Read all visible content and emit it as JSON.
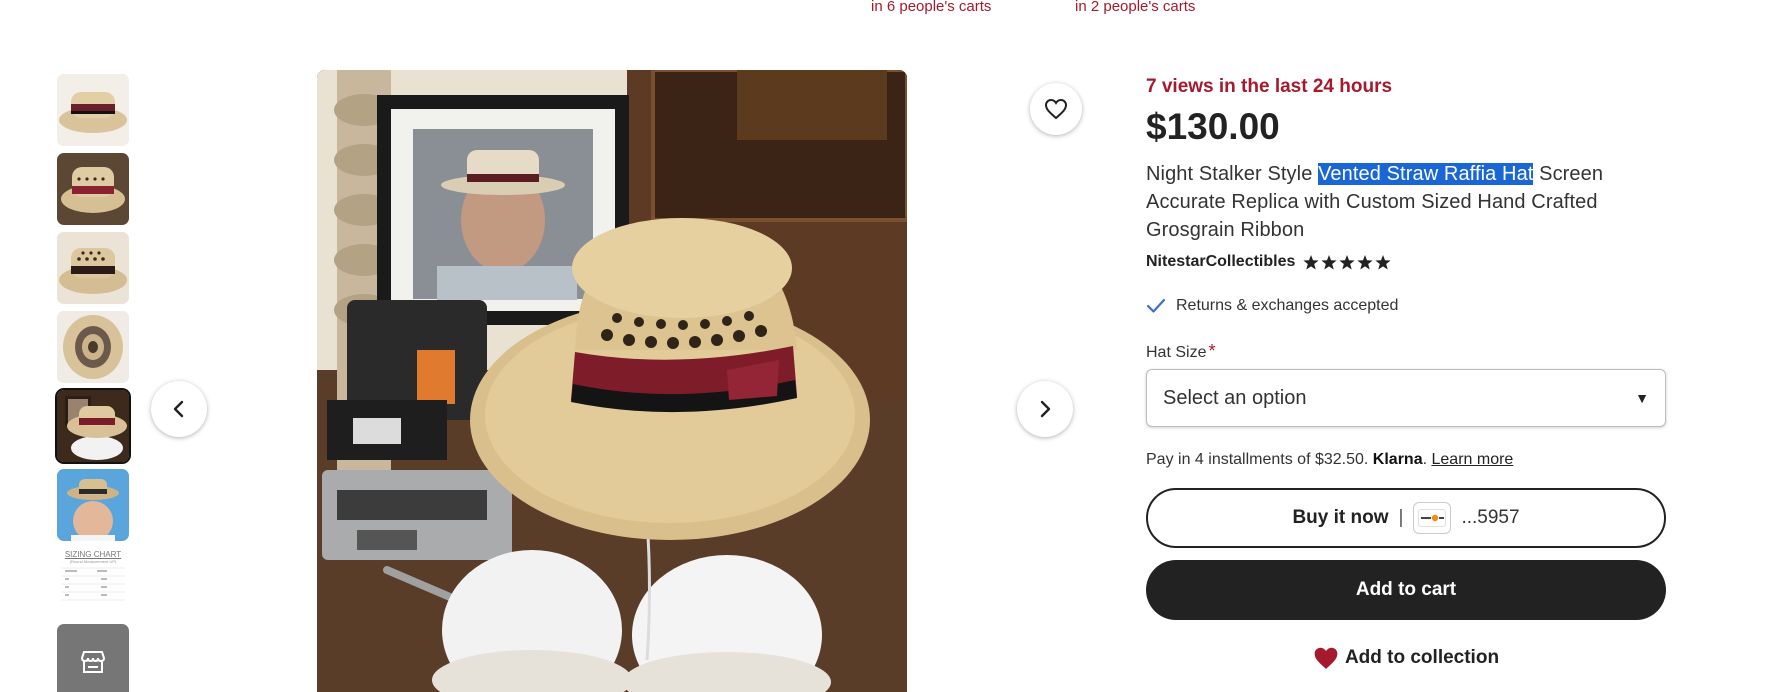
{
  "carts": {
    "note_1": "in 6 people's carts",
    "note_2": "in 2 people's carts"
  },
  "gallery": {
    "selected_index": 4,
    "sizing_chart_title": "SIZING CHART",
    "sizing_chart_sub": "(Round Measurement UP)",
    "icons": {
      "prev": "chevron-left-icon",
      "next": "chevron-right-icon",
      "favorite": "heart-outline-icon",
      "store": "store-icon"
    }
  },
  "product": {
    "views": "7 views in the last 24 hours",
    "price": "$130.00",
    "title_before": "Night Stalker Style ",
    "title_highlight": "Vented Straw Raffia Hat",
    "title_after": " Screen Accurate Replica with Custom Sized Hand Crafted Grosgrain Ribbon",
    "shop_name": "NitestarCollectibles",
    "rating_stars": 5,
    "returns_text": "Returns & exchanges accepted"
  },
  "options": {
    "size_label": "Hat Size",
    "required_mark": "*",
    "select_value": "Select an option"
  },
  "payment": {
    "installments_text": "Pay in 4 installments of $32.50. ",
    "klarna": "Klarna",
    "klarna_dot": ".",
    "learn_more": "Learn more",
    "buy_now_label": "Buy it now",
    "buy_now_sep": "|",
    "card_brand": "DISCOVER",
    "card_digits": "...5957",
    "add_to_cart": "Add to cart",
    "add_to_collection": "Add to collection"
  },
  "colors": {
    "accent_red": "#a61a2e",
    "button_dark": "#222222",
    "highlight": "#1a66d4"
  }
}
